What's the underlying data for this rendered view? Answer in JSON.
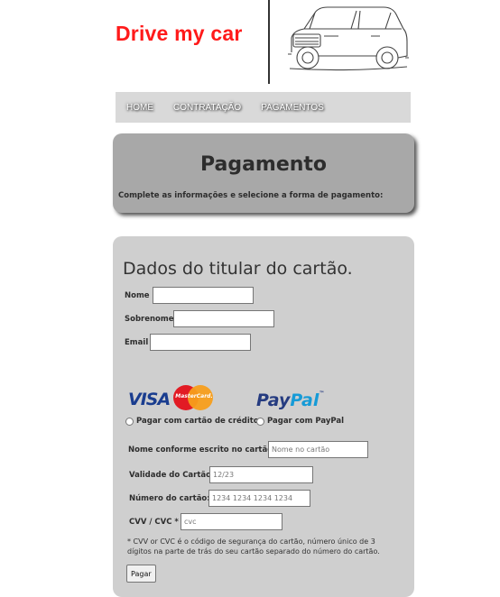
{
  "brand": {
    "name": "Drive my car",
    "logo_icon": "car-sketch-icon",
    "color": "#ff1a1a"
  },
  "nav": {
    "items": [
      "HOME",
      "CONTRATAÇÃO",
      "PAGAMENTOS"
    ]
  },
  "hero": {
    "title": "Pagamento",
    "subtitle": "Complete as informações e selecione a forma de pagamento:"
  },
  "holder": {
    "title": "Dados do titular do cartão.",
    "fields": [
      {
        "label": "Nome",
        "value": "",
        "placeholder": ""
      },
      {
        "label": "Sobrenome",
        "value": "",
        "placeholder": ""
      },
      {
        "label": "Email",
        "value": "",
        "placeholder": ""
      }
    ]
  },
  "payment_methods": {
    "visa_logo": "VISA",
    "mastercard_logo": "MasterCard.",
    "paypal_logo": {
      "pay": "Pay",
      "pal": "Pal",
      "tm": "™"
    },
    "credit_option": "Pagar com cartão de crédito",
    "paypal_option": "Pagar com PayPal"
  },
  "card": {
    "fields": [
      {
        "label": "Nome conforme escrito no cartão:",
        "value": "",
        "placeholder": "Nome no cartão"
      },
      {
        "label": "Validade do Cartão:",
        "value": "",
        "placeholder": "12/23"
      },
      {
        "label": "Número do cartão:",
        "value": "",
        "placeholder": "1234 1234 1234 1234"
      },
      {
        "label": "CVV / CVC *",
        "value": "",
        "placeholder": "cvc"
      }
    ],
    "note": "* CVV or CVC é o código de segurança do cartão, número único de 3 dígitos na parte de trás do seu cartão separado do número do cartão.",
    "submit_label": "Pagar"
  }
}
